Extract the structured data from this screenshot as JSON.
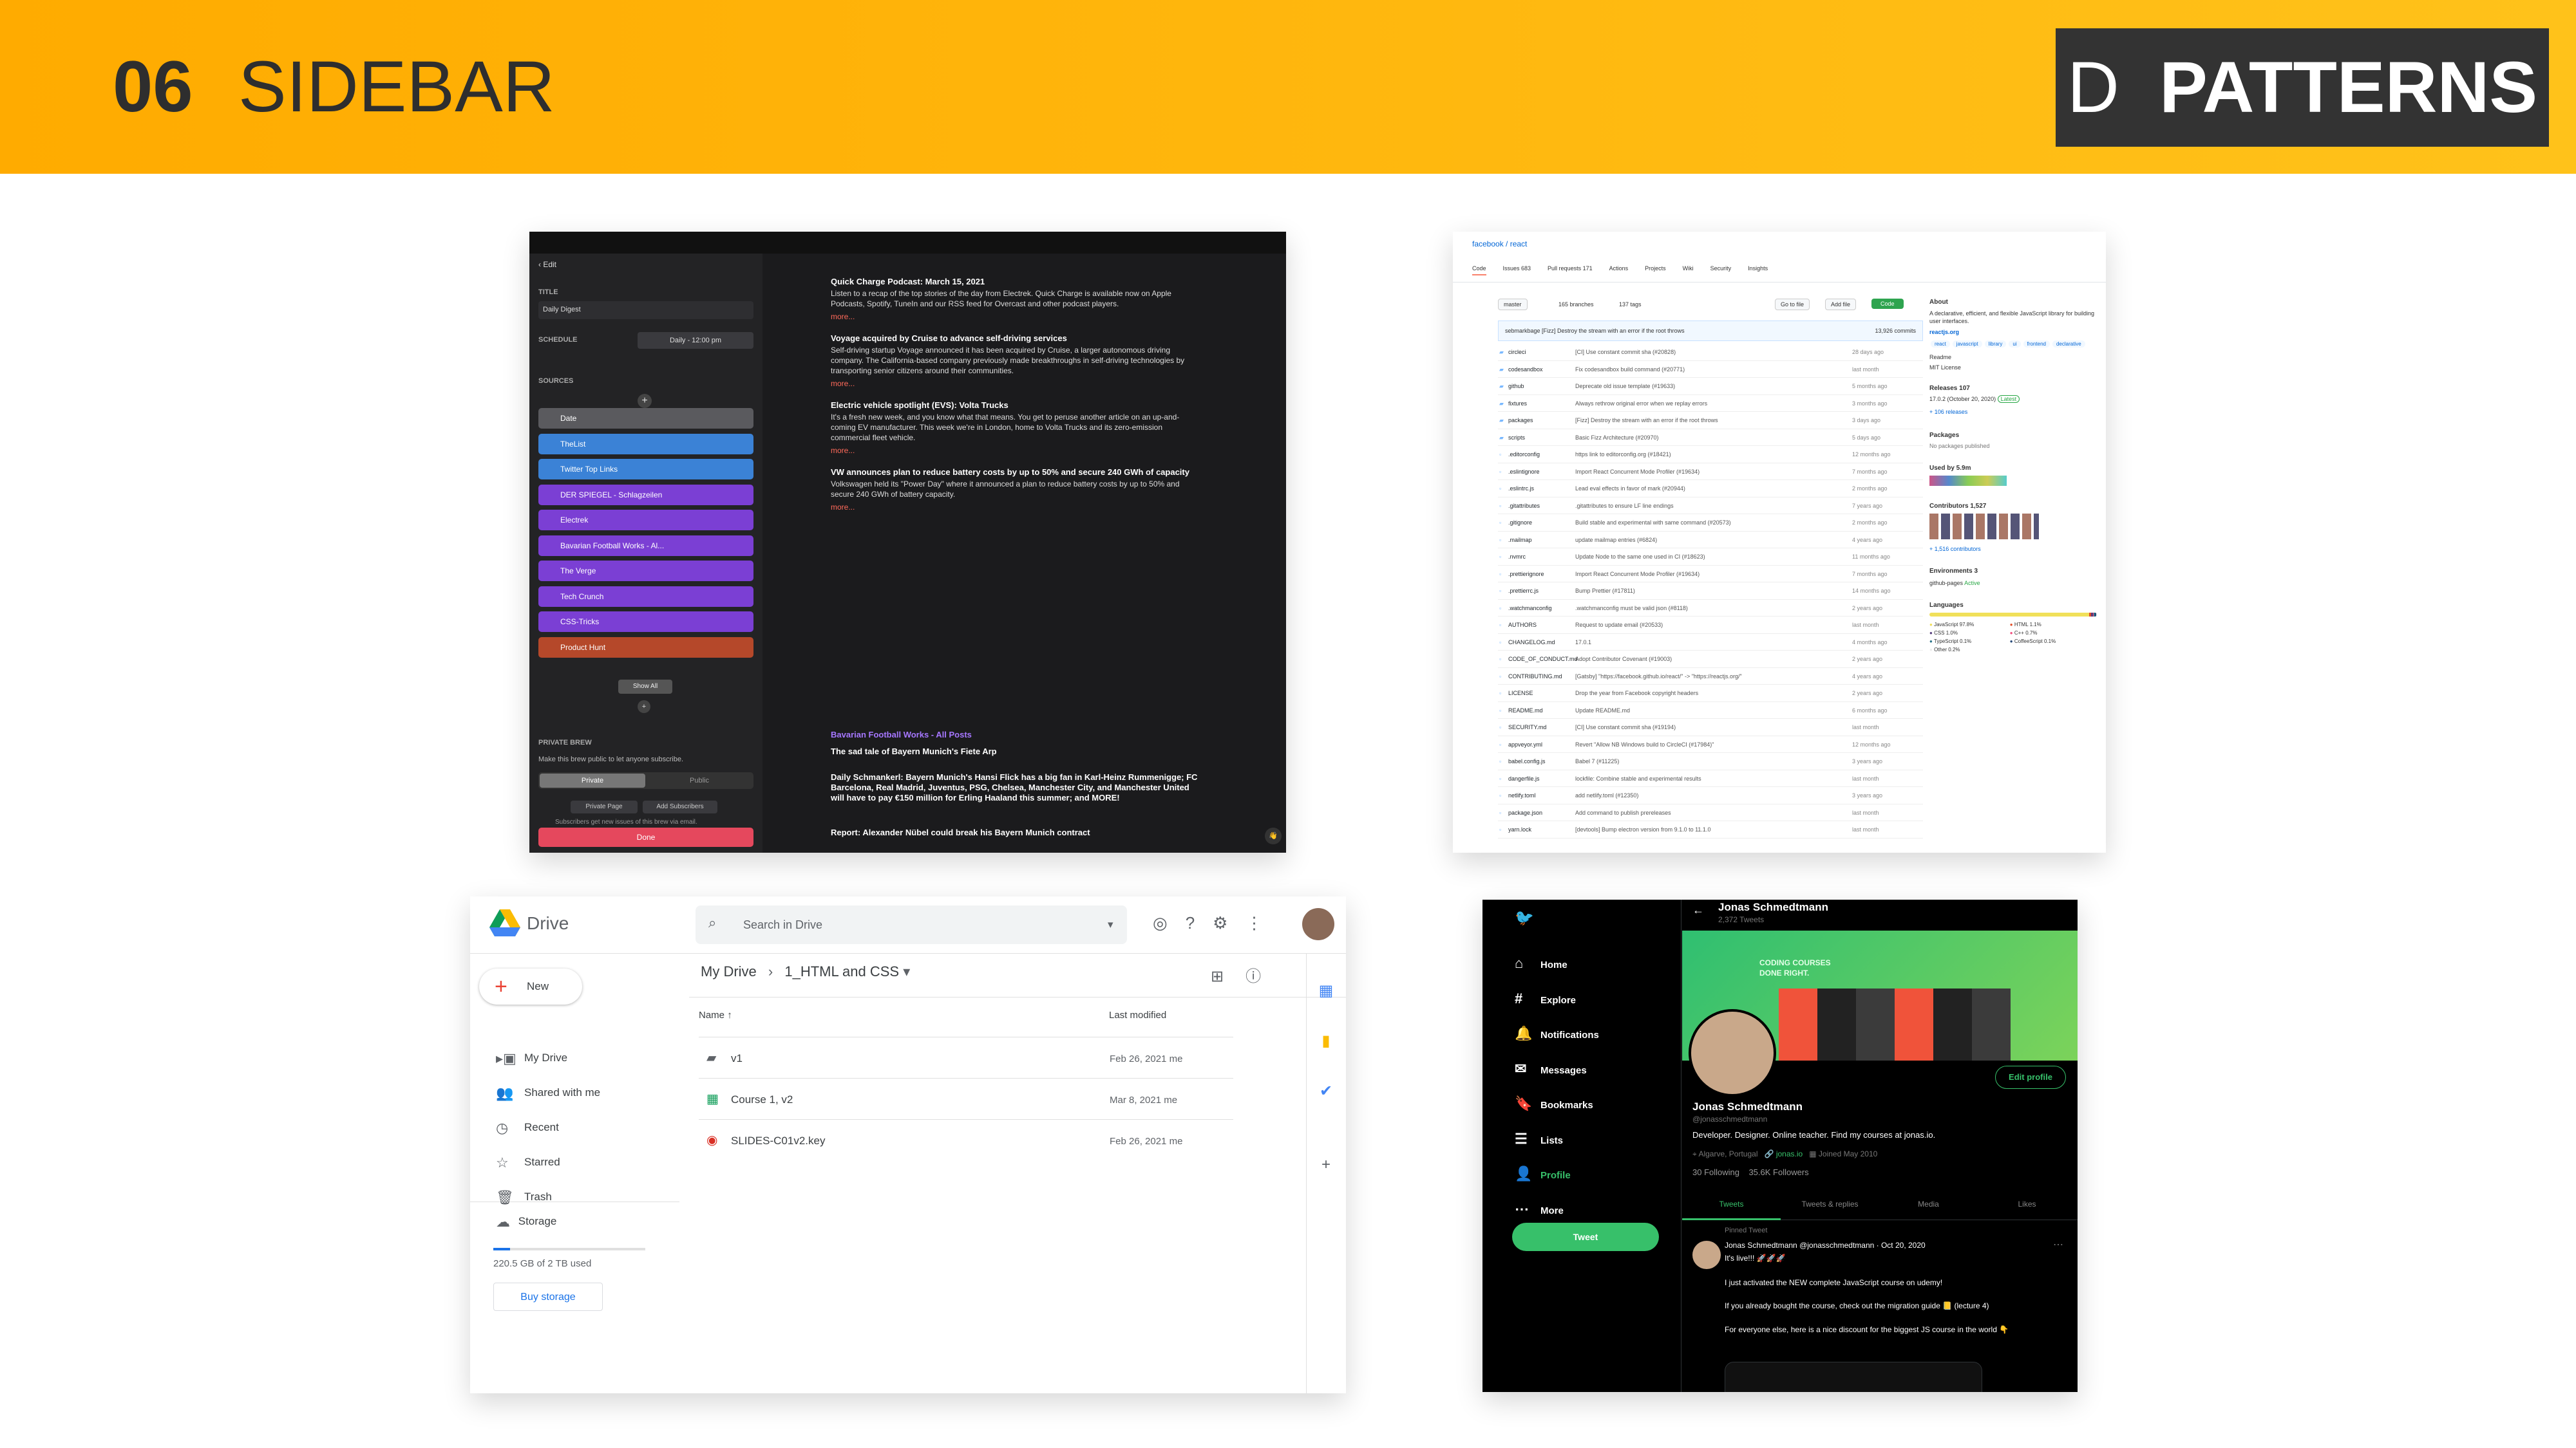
{
  "header": {
    "number": "06",
    "title": "SIDEBAR",
    "brand_d": "D",
    "brand_word": "PATTERNS"
  },
  "brew": {
    "edit": "‹ Edit",
    "title_label": "TITLE",
    "title_value": "Daily Digest",
    "schedule_label": "SCHEDULE",
    "schedule_value": "Daily - 12:00 pm",
    "sources_label": "SOURCES",
    "sources": [
      {
        "name": "Date",
        "color": "#5a5a5e"
      },
      {
        "name": "TheList",
        "color": "#3b82d6"
      },
      {
        "name": "Twitter Top Links",
        "color": "#3b82d6"
      },
      {
        "name": "DER SPIEGEL - Schlagzeilen",
        "color": "#7b3fd4"
      },
      {
        "name": "Electrek",
        "color": "#7b3fd4"
      },
      {
        "name": "Bavarian Football Works - Al...",
        "color": "#7b3fd4"
      },
      {
        "name": "The Verge",
        "color": "#7b3fd4"
      },
      {
        "name": "Tech Crunch",
        "color": "#7b3fd4"
      },
      {
        "name": "CSS-Tricks",
        "color": "#7b3fd4"
      },
      {
        "name": "Product Hunt",
        "color": "#b5482a"
      }
    ],
    "show_all": "Show All",
    "private_label": "PRIVATE BREW",
    "private_desc": "Make this brew public to let anyone subscribe.",
    "private_btn": "Private",
    "public_btn": "Public",
    "private_page": "Private Page",
    "add_subs": "Add Subscribers",
    "subs_note": "Subscribers get new issues of this brew via email.",
    "done": "Done",
    "articles": [
      {
        "title": "Quick Charge Podcast: March 15, 2021",
        "body": "Listen to a recap of the top stories of the day from Electrek. Quick Charge is available now on Apple Podcasts, Spotify, TuneIn and our RSS feed for Overcast and other podcast players."
      },
      {
        "title": "Voyage acquired by Cruise to advance self-driving services",
        "body": "Self-driving startup Voyage announced it has been acquired by Cruise, a larger autonomous driving company. The California-based company previously made breakthroughs in self-driving technologies by transporting senior citizens around their communities."
      },
      {
        "title": "Electric vehicle spotlight (EVS): Volta Trucks",
        "body": "It's a fresh new week, and you know what that means. You get to peruse another article on an up-and-coming EV manufacturer. This week we're in London, home to Volta Trucks and its zero-emission commercial fleet vehicle."
      },
      {
        "title": "VW announces plan to reduce battery costs by up to 50% and secure 240 GWh of capacity",
        "body": "Volkswagen held its \"Power Day\" where it announced a plan to reduce battery costs by up to 50% and secure 240 GWh of battery capacity."
      }
    ],
    "section": "Bavarian Football Works - All Posts",
    "art2_title": "The sad tale of Bayern Munich's Fiete Arp",
    "art3_title": "Daily Schmankerl: Bayern Munich's Hansi Flick has a big fan in Karl-Heinz Rummenigge; FC Barcelona, Real Madrid, Juventus, PSG, Chelsea, Manchester City, and Manchester United will have to pay €150 million for Erling Haaland this summer; and MORE!",
    "art4_title": "Report: Alexander Nübel could break his Bayern Munich contract"
  },
  "gh": {
    "repo": "facebook / react",
    "tabs": [
      "Code",
      "Issues 683",
      "Pull requests 171",
      "Actions",
      "Projects",
      "Wiki",
      "Security",
      "Insights"
    ],
    "branch": "master",
    "branches": "165 branches",
    "tags": "137 tags",
    "goto": "Go to file",
    "add": "Add file",
    "code": "Code",
    "commit": "sebmarkbage [Fizz] Destroy the stream with an error if the root throws",
    "commits": "13,926 commits",
    "files": [
      [
        "circleci",
        "[CI] Use constant commit sha (#20828)",
        "28 days ago"
      ],
      [
        "codesandbox",
        "Fix codesandbox build command (#20771)",
        "last month"
      ],
      [
        "github",
        "Deprecate old issue template (#19633)",
        "5 months ago"
      ],
      [
        "fixtures",
        "Always rethrow original error when we replay errors",
        "3 months ago"
      ],
      [
        "packages",
        "[Fizz] Destroy the stream with an error if the root throws",
        "3 days ago"
      ],
      [
        "scripts",
        "Basic Fizz Architecture (#20970)",
        "5 days ago"
      ],
      [
        ".editorconfig",
        "https link to editorconfig.org (#18421)",
        "12 months ago"
      ],
      [
        ".eslintignore",
        "Import React Concurrent Mode Profiler (#19634)",
        "7 months ago"
      ],
      [
        ".eslintrc.js",
        "Lead eval effects in favor of mark (#20944)",
        "2 months ago"
      ],
      [
        ".gitattributes",
        ".gitattributes to ensure LF line endings",
        "7 years ago"
      ],
      [
        ".gitignore",
        "Build stable and experimental with same command (#20573)",
        "2 months ago"
      ],
      [
        ".mailmap",
        "update mailmap entries (#6824)",
        "4 years ago"
      ],
      [
        ".nvmrc",
        "Update Node to the same one used in CI (#18623)",
        "11 months ago"
      ],
      [
        ".prettierignore",
        "Import React Concurrent Mode Profiler (#19634)",
        "7 months ago"
      ],
      [
        ".prettierrc.js",
        "Bump Prettier (#17811)",
        "14 months ago"
      ],
      [
        ".watchmanconfig",
        ".watchmanconfig must be valid json (#8118)",
        "2 years ago"
      ],
      [
        "AUTHORS",
        "Request to update email (#20533)",
        "last month"
      ],
      [
        "CHANGELOG.md",
        "17.0.1",
        "4 months ago"
      ],
      [
        "CODE_OF_CONDUCT.md",
        "Adopt Contributor Covenant (#19003)",
        "2 years ago"
      ],
      [
        "CONTRIBUTING.md",
        "[Gatsby] \"https://facebook.github.io/react/\" -> \"https://reactjs.org/\"",
        "4 years ago"
      ],
      [
        "LICENSE",
        "Drop the year from Facebook copyright headers",
        "2 years ago"
      ],
      [
        "README.md",
        "Update README.md",
        "6 months ago"
      ],
      [
        "SECURITY.md",
        "[CI] Use constant commit sha (#19194)",
        "last month"
      ],
      [
        "appveyor.yml",
        "Revert \"Allow NB Windows build to CircleCI (#17984)\"",
        "12 months ago"
      ],
      [
        "babel.config.js",
        "Babel 7 (#11225)",
        "3 years ago"
      ],
      [
        "dangerfile.js",
        "lockfile: Combine stable and experimental results",
        "last month"
      ],
      [
        "netlify.toml",
        "add netlify.toml (#12350)",
        "3 years ago"
      ],
      [
        "package.json",
        "Add command to publish prereleases",
        "last month"
      ],
      [
        "yarn.lock",
        "[devtools] Bump electron version from 9.1.0 to 11.1.0",
        "last month"
      ]
    ],
    "about": "About",
    "about_desc": "A declarative, efficient, and flexible JavaScript library for building user interfaces.",
    "site": "reactjs.org",
    "topics": [
      "react",
      "javascript",
      "library",
      "ui",
      "frontend",
      "declarative"
    ],
    "readme": "Readme",
    "license": "MIT License",
    "releases": "Releases 107",
    "release": "17.0.2 (October 20, 2020)",
    "latest": "Latest",
    "more_rel": "+ 106 releases",
    "packages": "Packages",
    "no_pkg": "No packages published",
    "usedby": "Used by 5.9m",
    "contrib": "Contributors 1,527",
    "more_contrib": "+ 1,516 contributors",
    "env": "Environments 3",
    "ghpages": "github-pages",
    "active": "Active",
    "languages": "Languages",
    "langs": [
      [
        "JavaScript 97.8%",
        "#f1e05a"
      ],
      [
        "HTML 1.1%",
        "#e34c26"
      ],
      [
        "CSS 1.0%",
        "#563d7c"
      ],
      [
        "C++ 0.7%",
        "#f34b7d"
      ],
      [
        "TypeScript 0.1%",
        "#2b7489"
      ],
      [
        "CoffeeScript 0.1%",
        "#244776"
      ],
      [
        "Other 0.2%",
        "#ededed"
      ]
    ]
  },
  "drive": {
    "logo": "Drive",
    "search": "Search in Drive",
    "new": "New",
    "nav": [
      [
        "My Drive",
        "▸▣"
      ],
      [
        "Shared with me",
        "👥"
      ],
      [
        "Recent",
        "◷"
      ],
      [
        "Starred",
        "☆"
      ],
      [
        "Trash",
        "🗑"
      ]
    ],
    "storage": "Storage",
    "used": "220.5 GB of 2 TB used",
    "buy": "Buy storage",
    "crumb1": "My Drive",
    "crumb2": "1_HTML and CSS",
    "col_name": "Name",
    "col_mod": "Last modified",
    "rows": [
      [
        "v1",
        "Feb 26, 2021 me",
        "#5f6368",
        "▰"
      ],
      [
        "Course 1, v2",
        "Mar 8, 2021 me",
        "#0f9d58",
        "▦"
      ],
      [
        "SLIDES-C01v2.key",
        "Feb 26, 2021 me",
        "#d93025",
        "◉"
      ]
    ]
  },
  "tw": {
    "nav": [
      [
        "Home",
        "⌂"
      ],
      [
        "Explore",
        "#"
      ],
      [
        "Notifications",
        "🔔"
      ],
      [
        "Messages",
        "✉"
      ],
      [
        "Bookmarks",
        "🔖"
      ],
      [
        "Lists",
        "☰"
      ],
      [
        "Profile",
        "👤"
      ],
      [
        "More",
        "⋯"
      ]
    ],
    "tweet_btn": "Tweet",
    "name": "Jonas Schmedtmann",
    "count": "2,372 Tweets",
    "banner1": "CODING COURSES",
    "banner2": "DONE RIGHT.",
    "edit": "Edit profile",
    "handle": "@jonasschmedtmann",
    "bio": "Developer. Designer. Online teacher. Find my courses at jonas.io.",
    "location": "Algarve, Portugal",
    "link": "jonas.io",
    "joined": "Joined May 2010",
    "following": "30 Following",
    "followers": "35.6K Followers",
    "tabs": [
      "Tweets",
      "Tweets & replies",
      "Media",
      "Likes"
    ],
    "pinned": "Pinned Tweet",
    "tw_head": "Jonas Schmedtmann @jonasschmedtmann · Oct 20, 2020",
    "tw1": "It's live!!! 🚀🚀🚀",
    "tw2": "I just activated the NEW complete JavaScript course on udemy!",
    "tw3": "If you already bought the course, check out the migration guide 📒 (lecture 4)",
    "tw4": "For everyone else, here is a nice discount for the biggest JS course in the world 👇"
  }
}
